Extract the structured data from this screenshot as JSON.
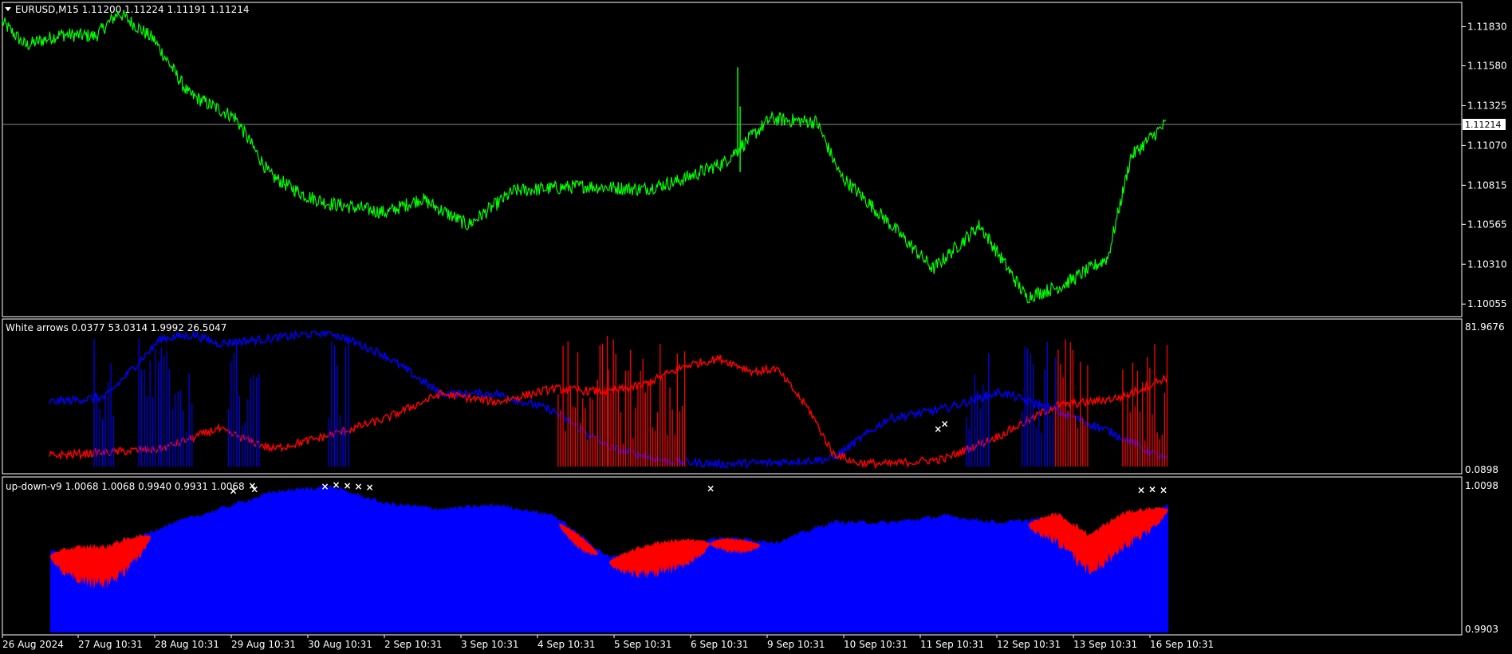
{
  "colors": {
    "background": "#000000",
    "frame": "#ffffff",
    "price_line": "#00ff00",
    "blue_series": "#0000ff",
    "red_series": "#ff0000",
    "arrow": "#ffffff"
  },
  "main_panel": {
    "title": "EURUSD,M15  1.11200 1.11224 1.11191 1.11214",
    "current_price": "1.11214",
    "y_ticks": [
      "1.11830",
      "1.11580",
      "1.11325",
      "1.11070",
      "1.10815",
      "1.10565",
      "1.10310",
      "1.10055"
    ]
  },
  "indicator1": {
    "title": "White arrows 0.0377 53.0314 1.9992 26.5047",
    "y_max": "81.9676",
    "y_min_overlap": "0.0898"
  },
  "indicator2": {
    "title": "up-down-v9 1.0068 1.0068 0.9940 0.9931 1.0068",
    "y_max": "1.0098",
    "y_min": "0.9903"
  },
  "x_axis": {
    "labels": [
      "26 Aug 2024",
      "27 Aug 10:31",
      "28 Aug 10:31",
      "29 Aug 10:31",
      "30 Aug 10:31",
      "2 Sep 10:31",
      "3 Sep 10:31",
      "4 Sep 10:31",
      "5 Sep 10:31",
      "6 Sep 10:31",
      "9 Sep 10:31",
      "10 Sep 10:31",
      "11 Sep 10:31",
      "12 Sep 10:31",
      "13 Sep 10:31",
      "16 Sep 10:31"
    ]
  },
  "chart_data": [
    {
      "type": "line",
      "title": "EURUSD,M15",
      "ylim": [
        1.1,
        1.1196
      ],
      "current": 1.11214,
      "series": [
        {
          "name": "EURUSD",
          "x": [
            0,
            0.02,
            0.05,
            0.08,
            0.1,
            0.13,
            0.16,
            0.2,
            0.23,
            0.26,
            0.28,
            0.33,
            0.36,
            0.4,
            0.44,
            0.5,
            0.55,
            0.58,
            0.62,
            0.66,
            0.7,
            0.72,
            0.76,
            0.8,
            0.84,
            0.88,
            0.91,
            0.95,
            0.97,
            1.0
          ],
          "values": [
            1.1186,
            1.1171,
            1.1178,
            1.1177,
            1.1192,
            1.1175,
            1.114,
            1.1125,
            1.1088,
            1.1075,
            1.107,
            1.1064,
            1.1073,
            1.1056,
            1.1078,
            1.1081,
            1.1079,
            1.1084,
            1.1096,
            1.1124,
            1.1122,
            1.1088,
            1.1059,
            1.1028,
            1.1056,
            1.101,
            1.1017,
            1.1035,
            1.11,
            1.1121
          ]
        }
      ]
    },
    {
      "type": "line",
      "title": "White arrows",
      "ylim": [
        0.0898,
        81.9676
      ],
      "series": [
        {
          "name": "White arrows",
          "x": [
            0,
            0.05,
            0.1,
            0.13,
            0.15,
            0.2,
            0.25,
            0.3,
            0.35,
            0.4,
            0.45,
            0.5,
            0.55,
            0.6,
            0.65,
            0.7,
            0.75,
            0.8,
            0.85,
            0.9,
            0.95,
            1.0
          ],
          "values": [
            40,
            43,
            78,
            80,
            75,
            78,
            82,
            68,
            45,
            45,
            35,
            13,
            5,
            3,
            4,
            6,
            30,
            36,
            46,
            35,
            22,
            5
          ]
        },
        {
          "name": "",
          "x": [
            0,
            0.05,
            0.1,
            0.15,
            0.2,
            0.25,
            0.3,
            0.35,
            0.4,
            0.45,
            0.5,
            0.53,
            0.57,
            0.6,
            0.63,
            0.65,
            0.68,
            0.7,
            0.72,
            0.75,
            0.8,
            0.85,
            0.9,
            0.93,
            0.96,
            1.0
          ],
          "values": [
            8,
            10,
            12,
            24,
            12,
            20,
            30,
            45,
            40,
            48,
            46,
            50,
            62,
            66,
            58,
            60,
            35,
            10,
            4,
            3,
            6,
            20,
            38,
            40,
            43,
            55
          ]
        }
      ]
    },
    {
      "type": "area",
      "title": "up-down-v9",
      "ylim": [
        0.9903,
        1.0098
      ],
      "series": [
        {
          "name": "up-down-v9",
          "x": [
            0,
            0.05,
            0.1,
            0.15,
            0.2,
            0.25,
            0.3,
            0.35,
            0.4,
            0.45,
            0.5,
            0.55,
            0.6,
            0.65,
            0.7,
            0.75,
            0.8,
            0.85,
            0.9,
            0.93,
            0.96,
            1.0
          ],
          "values": [
            1.0008,
            1.0005,
            1.004,
            1.0062,
            1.0085,
            1.0092,
            1.007,
            1.0063,
            1.0068,
            1.0055,
            1.0,
            1.0015,
            1.0026,
            1.002,
            1.0046,
            1.0045,
            1.0054,
            1.0045,
            1.0052,
            1.002,
            1.005,
            1.0068
          ]
        }
      ]
    }
  ]
}
